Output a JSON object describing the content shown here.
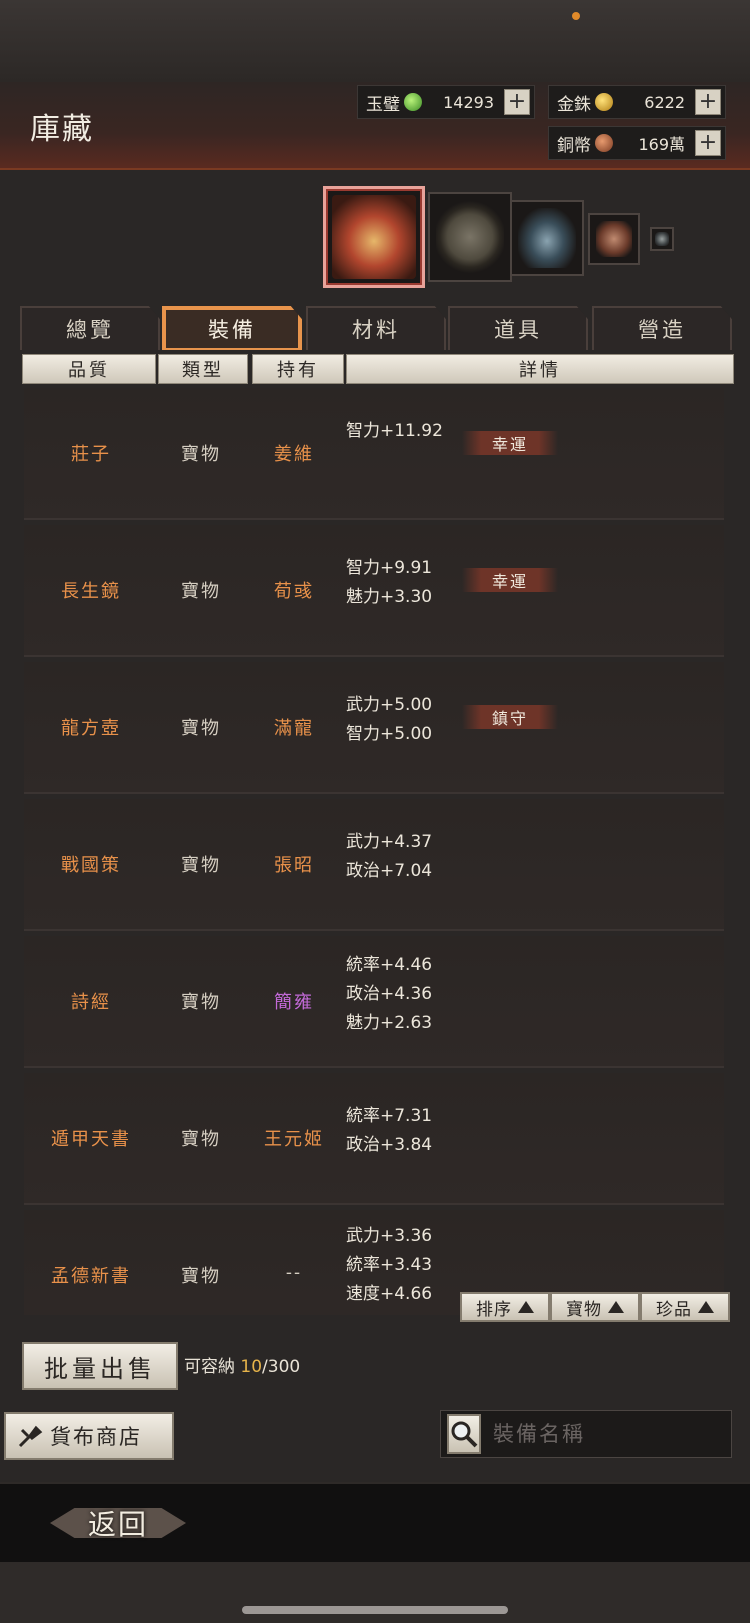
{
  "header": {
    "title": "庫藏"
  },
  "currencies": [
    {
      "label": "玉璧",
      "icon": "jade-coin-icon",
      "value": "14293"
    },
    {
      "label": "金銖",
      "icon": "gold-coin-icon",
      "value": "6222"
    },
    {
      "label": "銅幣",
      "icon": "copper-coin-icon",
      "value": "169萬"
    }
  ],
  "plus_label": "+",
  "tabs": [
    "總覽",
    "裝備",
    "材料",
    "道具",
    "營造"
  ],
  "active_tab": "裝備",
  "columns": [
    "品質",
    "類型",
    "持有",
    "詳情"
  ],
  "items": [
    {
      "name": "莊子",
      "type": "寶物",
      "owner": "姜維",
      "stats": [
        "智力+11.92"
      ],
      "badge": "幸運"
    },
    {
      "name": "長生鏡",
      "type": "寶物",
      "owner": "荀彧",
      "stats": [
        "智力+9.91",
        "魅力+3.30"
      ],
      "badge": "幸運"
    },
    {
      "name": "龍方壺",
      "type": "寶物",
      "owner": "滿寵",
      "stats": [
        "武力+5.00",
        "智力+5.00"
      ],
      "badge": "鎮守"
    },
    {
      "name": "戰國策",
      "type": "寶物",
      "owner": "張昭",
      "stats": [
        "武力+4.37",
        "政治+7.04"
      ],
      "badge": ""
    },
    {
      "name": "詩經",
      "type": "寶物",
      "owner": "簡雍",
      "owner_color": "purple",
      "stats": [
        "統率+4.46",
        "政治+4.36",
        "魅力+2.63"
      ],
      "badge": ""
    },
    {
      "name": "遁甲天書",
      "type": "寶物",
      "owner": "王元姬",
      "stats": [
        "統率+7.31",
        "政治+3.84"
      ],
      "badge": ""
    },
    {
      "name": "孟德新書",
      "type": "寶物",
      "owner": "--",
      "owner_color": "gray",
      "stats": [
        "武力+3.36",
        "統率+3.43",
        "速度+4.66"
      ],
      "badge": ""
    }
  ],
  "sort_buttons": [
    "排序",
    "寶物",
    "珍品"
  ],
  "bulk_sell_label": "批量出售",
  "capacity": {
    "label": "可容納",
    "used": "10",
    "max": "/300"
  },
  "shop_label": "貨布商店",
  "search": {
    "placeholder": "裝備名稱",
    "value": ""
  },
  "back_label": "返回"
}
